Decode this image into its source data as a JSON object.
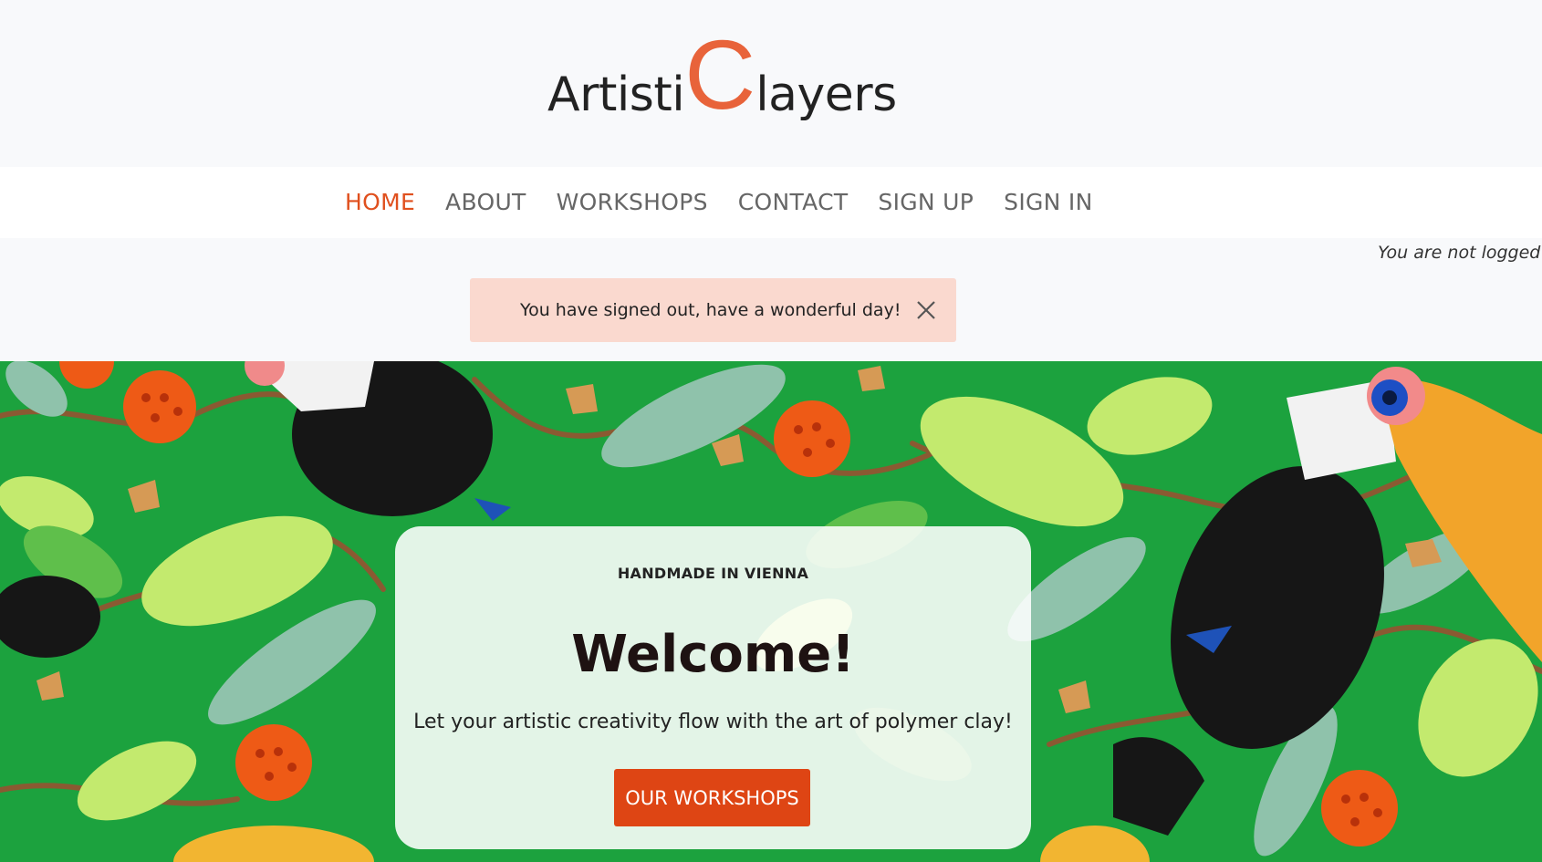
{
  "logo": {
    "part1": "Artisti",
    "big_letter": "C",
    "part2": "layers",
    "accent_color": "#e8633a"
  },
  "nav": {
    "items": [
      {
        "label": "HOME",
        "active": true
      },
      {
        "label": "ABOUT"
      },
      {
        "label": "WORKSHOPS"
      },
      {
        "label": "CONTACT"
      },
      {
        "label": "SIGN UP"
      },
      {
        "label": "SIGN IN"
      }
    ],
    "active_color": "#e0501e"
  },
  "status": {
    "login_text": "You are not logged in"
  },
  "alert": {
    "message": "You have signed out, have a wonderful day!",
    "close_icon": "close-icon",
    "bg_color": "#fad9cf"
  },
  "hero": {
    "eyebrow": "HANDMADE IN VIENNA",
    "title": "Welcome!",
    "tagline": "Let your artistic creativity flow with the art of polymer clay!",
    "cta_label": "OUR WORKSHOPS",
    "cta_color": "#de4514"
  }
}
